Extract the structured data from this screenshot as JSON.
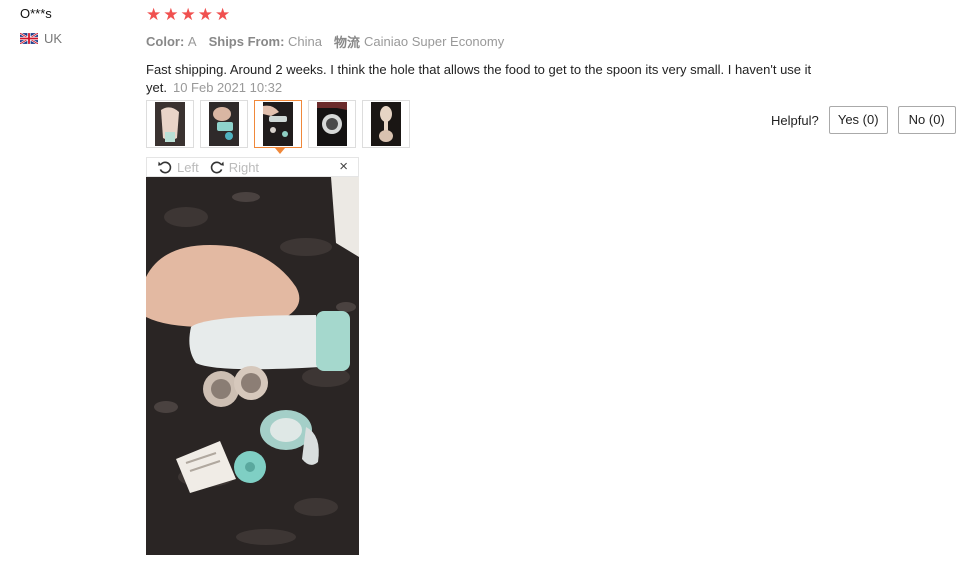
{
  "user": {
    "name": "O***s",
    "country": "UK",
    "flag_icon": "uk-flag-icon"
  },
  "review": {
    "rating": 5,
    "star_color": "#f0504f",
    "color_label": "Color:",
    "color_value": "A",
    "ships_from_label": "Ships From:",
    "ships_from_value": "China",
    "shipping_method_label": "物流",
    "shipping_method_value": "Cainiao Super Economy",
    "text": "Fast shipping. Around 2 weeks. I think the hole that allows the food to get to the spoon its very small. I haven't use it yet.",
    "date": "10 Feb 2021 10:32"
  },
  "helpful": {
    "label": "Helpful?",
    "yes_label": "Yes (0)",
    "no_label": "No (0)"
  },
  "viewer": {
    "rotate_left_label": "Left",
    "rotate_right_label": "Right",
    "close_label": "×"
  },
  "thumbnails": {
    "count": 5,
    "active_index": 2,
    "active_border_color": "#f0883a"
  }
}
